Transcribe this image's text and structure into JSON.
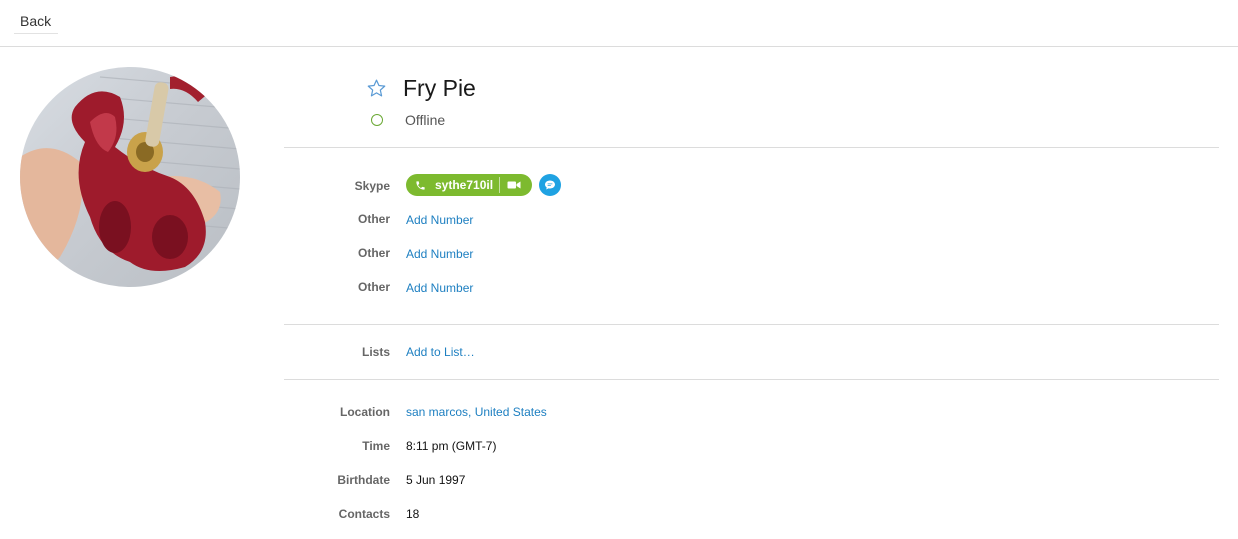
{
  "topbar": {
    "back_label": "Back"
  },
  "profile": {
    "name": "Fry Pie",
    "status": "Offline",
    "status_color": "#6aa834"
  },
  "contact": {
    "skype_label": "Skype",
    "skype_id": "sythe710il",
    "skype_pill_color": "#7dba2f",
    "chat_color": "#1fa2e2",
    "others": [
      {
        "label": "Other",
        "action": "Add Number"
      },
      {
        "label": "Other",
        "action": "Add Number"
      },
      {
        "label": "Other",
        "action": "Add Number"
      }
    ]
  },
  "lists": {
    "label": "Lists",
    "action": "Add to List…"
  },
  "details": {
    "location_label": "Location",
    "location_city": "san marcos",
    "location_country": "United States",
    "time_label": "Time",
    "time_value": "8:11 pm (GMT-7)",
    "birthdate_label": "Birthdate",
    "birthdate_value": "5 Jun 1997",
    "contacts_label": "Contacts",
    "contacts_value": "18"
  },
  "icons": {
    "favorite": "star-icon",
    "presence": "status-ring-icon",
    "call": "phone-icon",
    "video": "video-camera-icon",
    "chat": "chat-bubble-icon"
  },
  "link_color": "#1d7fc1"
}
